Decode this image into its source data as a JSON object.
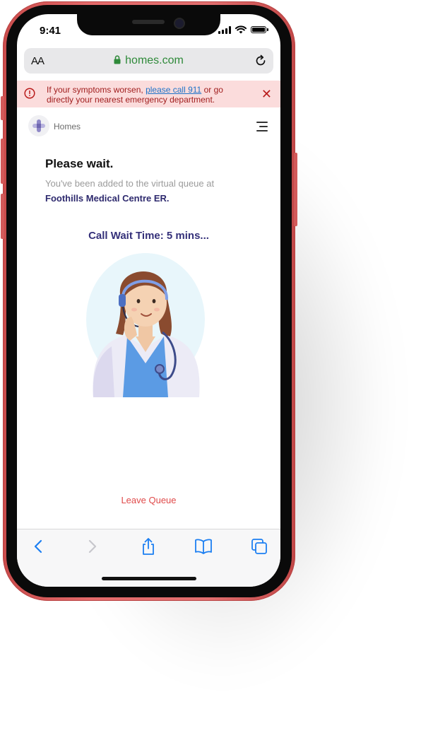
{
  "status_bar": {
    "time": "9:41"
  },
  "browser": {
    "text_size_label": "AA",
    "url": "homes.com",
    "icons": [
      "lock-icon",
      "reload-icon"
    ]
  },
  "alert": {
    "text_before": "If your symptoms worsen,",
    "link": "please call 911",
    "text_after": "or go directly your nearest emergency department.",
    "close": "✕",
    "color": "#fbdcdc"
  },
  "site": {
    "brand": "Homes",
    "icons": [
      "logo-icon",
      "hamburger-menu-icon"
    ]
  },
  "main": {
    "title": "Please wait.",
    "subtitle": "You've been added to the virtual queue at",
    "facility": "Foothills Medical Centre ER.",
    "wait_time": "Call Wait Time: 5 mins...",
    "leave_button": "Leave Queue"
  },
  "toolbar": {
    "icons": [
      "back-icon",
      "forward-icon",
      "share-icon",
      "bookmarks-icon",
      "tabs-icon"
    ]
  },
  "colors": {
    "accent": "#35317a",
    "danger": "#e04a4a",
    "url_green": "#2f8a3a",
    "frame_red": "#e46b6b"
  }
}
